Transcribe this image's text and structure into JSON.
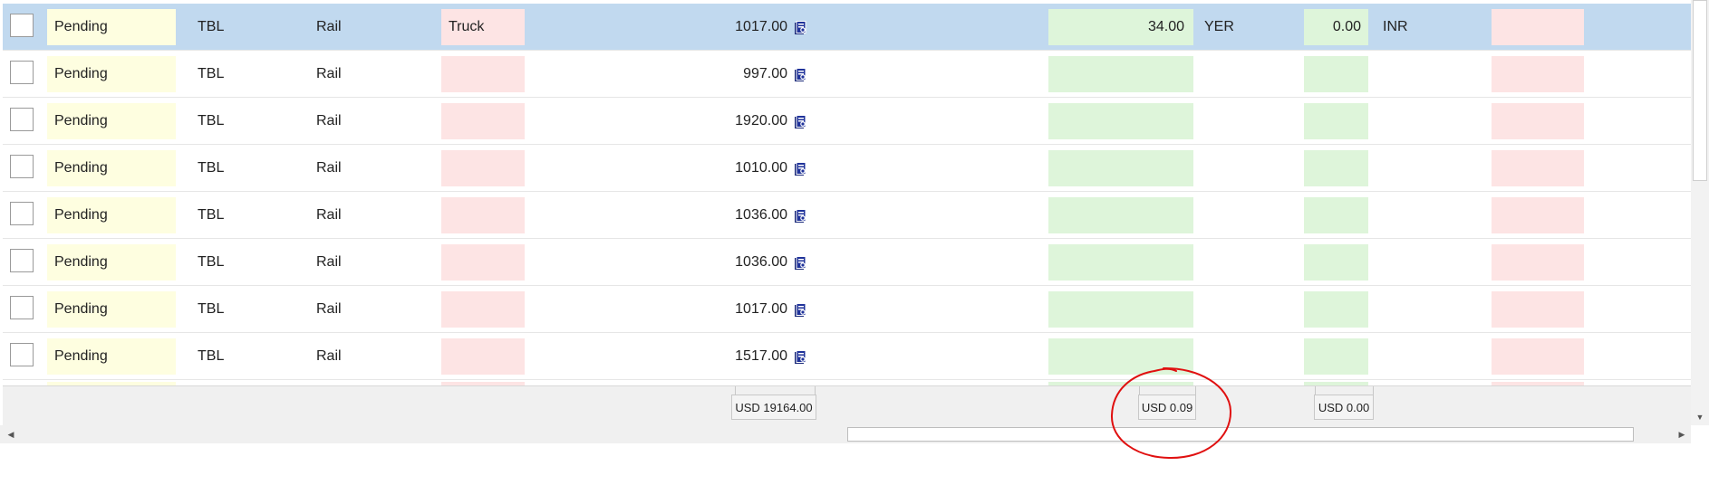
{
  "rows": [
    {
      "status": "Pending",
      "doc_type": "TBL",
      "mode": "Rail",
      "transport": "Truck",
      "amount": "1017.00",
      "value1": "34.00",
      "currency1": "YER",
      "value2": "0.00",
      "currency2": "INR",
      "selected": true
    },
    {
      "status": "Pending",
      "doc_type": "TBL",
      "mode": "Rail",
      "transport": "",
      "amount": "997.00",
      "value1": "",
      "currency1": "",
      "value2": "",
      "currency2": "",
      "selected": false
    },
    {
      "status": "Pending",
      "doc_type": "TBL",
      "mode": "Rail",
      "transport": "",
      "amount": "1920.00",
      "value1": "",
      "currency1": "",
      "value2": "",
      "currency2": "",
      "selected": false
    },
    {
      "status": "Pending",
      "doc_type": "TBL",
      "mode": "Rail",
      "transport": "",
      "amount": "1010.00",
      "value1": "",
      "currency1": "",
      "value2": "",
      "currency2": "",
      "selected": false
    },
    {
      "status": "Pending",
      "doc_type": "TBL",
      "mode": "Rail",
      "transport": "",
      "amount": "1036.00",
      "value1": "",
      "currency1": "",
      "value2": "",
      "currency2": "",
      "selected": false
    },
    {
      "status": "Pending",
      "doc_type": "TBL",
      "mode": "Rail",
      "transport": "",
      "amount": "1036.00",
      "value1": "",
      "currency1": "",
      "value2": "",
      "currency2": "",
      "selected": false
    },
    {
      "status": "Pending",
      "doc_type": "TBL",
      "mode": "Rail",
      "transport": "",
      "amount": "1017.00",
      "value1": "",
      "currency1": "",
      "value2": "",
      "currency2": "",
      "selected": false
    },
    {
      "status": "Pending",
      "doc_type": "TBL",
      "mode": "Rail",
      "transport": "",
      "amount": "1517.00",
      "value1": "",
      "currency1": "",
      "value2": "",
      "currency2": "",
      "selected": false
    }
  ],
  "footer": {
    "total_amount": "USD 19164.00",
    "total_value1": "USD 0.09",
    "total_value2": "USD 0.00"
  },
  "icons": {
    "row_action": "document-icon",
    "annotation": "red-circle-annotation"
  },
  "colors": {
    "selected_row": "#c1d9ef",
    "status_cell": "#fefee0",
    "pink_cell": "#fde4e4",
    "green_cell": "#def5da",
    "annotation": "#e01010"
  }
}
